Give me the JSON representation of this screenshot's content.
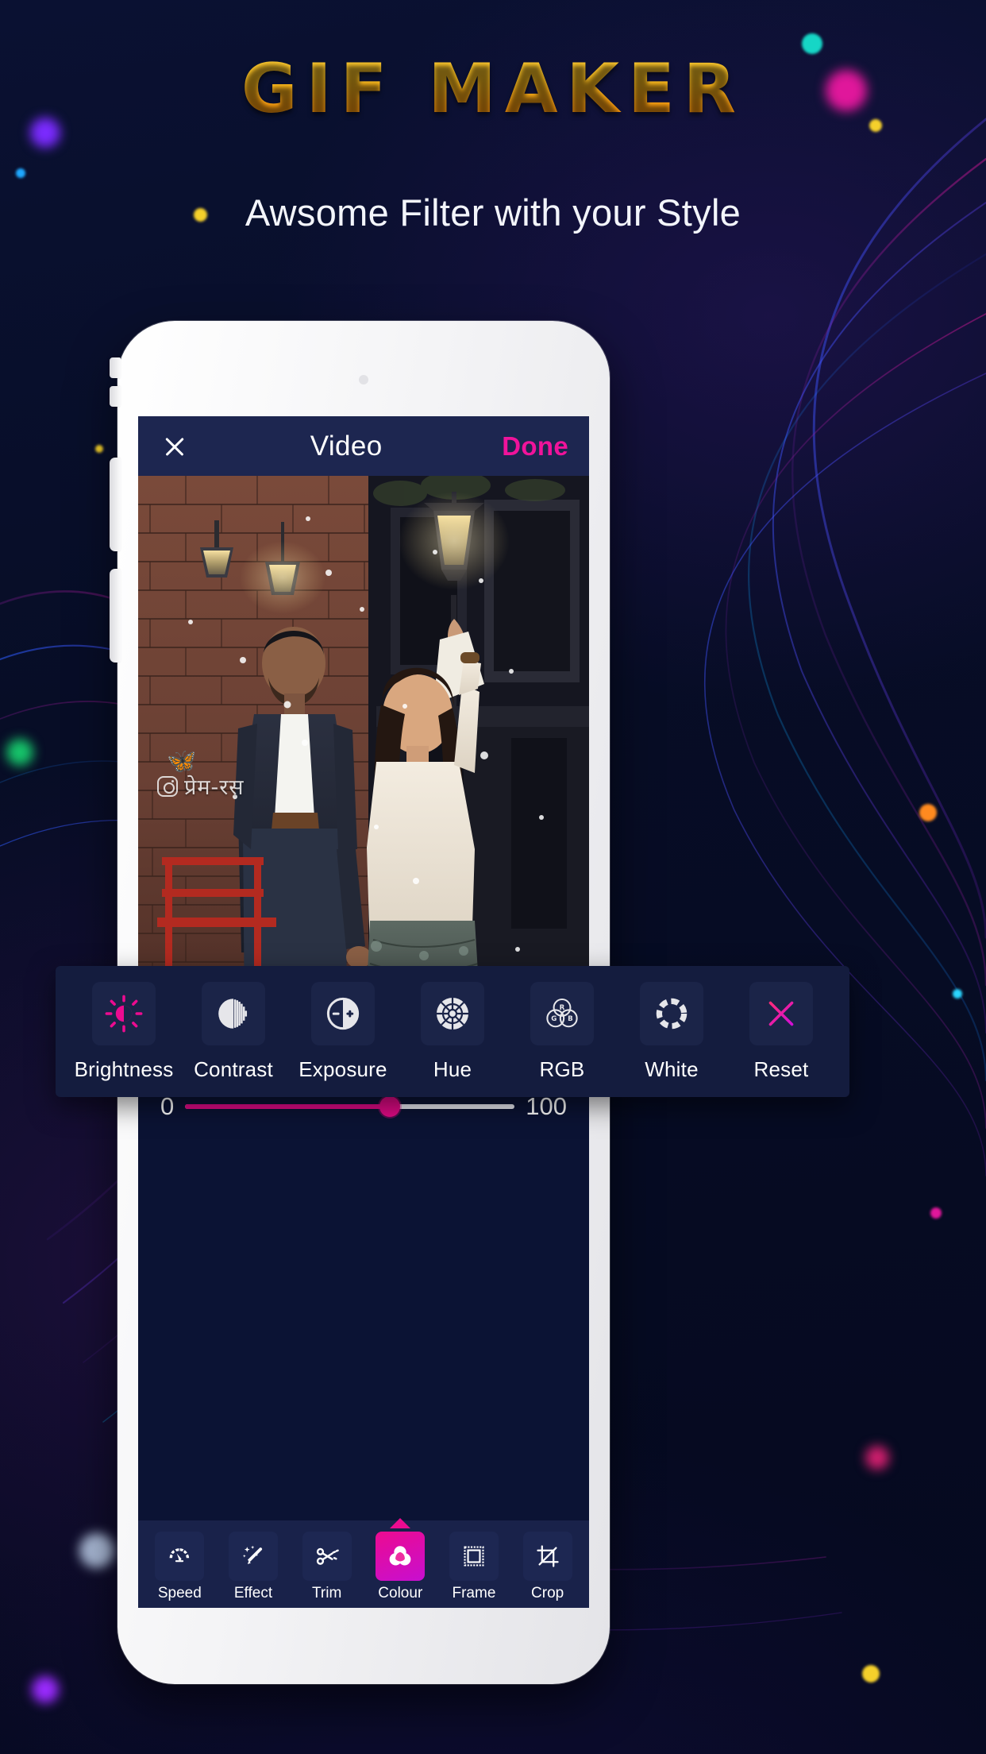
{
  "hero": {
    "title": "GIF MAKER",
    "subtitle": "Awsome Filter with your Style",
    "title_gradient_from": "#ffd23a",
    "title_gradient_to": "#ff8c05"
  },
  "app": {
    "header": {
      "close_icon": "close-icon",
      "title": "Video",
      "done_label": "Done",
      "done_color": "#f0139b",
      "bar_color": "#1d2650"
    },
    "preview": {
      "watermark_handle": "प्रेम-रस",
      "watermark_icon": "instagram-icon"
    },
    "adjust": {
      "name": "Brightness",
      "min_label": "0",
      "max_label": "100",
      "value": 62,
      "fill_color": "#e20a87",
      "track_color": "#e9eaf2"
    },
    "filter_panel": {
      "items": [
        {
          "label": "Brightness",
          "icon": "brightness-sun-icon",
          "active": true
        },
        {
          "label": "Contrast",
          "icon": "contrast-circle-icon",
          "active": false
        },
        {
          "label": "Exposure",
          "icon": "exposure-plusminus-icon",
          "active": false
        },
        {
          "label": "Hue",
          "icon": "hue-wheel-icon",
          "active": false
        },
        {
          "label": "RGB",
          "icon": "rgb-venn-icon",
          "active": false
        },
        {
          "label": "White",
          "icon": "white-balance-dashed-ring-icon",
          "active": false
        },
        {
          "label": "Reset",
          "icon": "reset-x-icon",
          "active": false
        }
      ],
      "accent_color": "#e20a87",
      "panel_color": "#141c3e"
    },
    "bottom_nav": {
      "items": [
        {
          "label": "Speed",
          "icon": "speedometer-icon",
          "active": false
        },
        {
          "label": "Effect",
          "icon": "magic-wand-icon",
          "active": false
        },
        {
          "label": "Trim",
          "icon": "scissors-icon",
          "active": false
        },
        {
          "label": "Colour",
          "icon": "colour-venn-icon",
          "active": true
        },
        {
          "label": "Frame",
          "icon": "frame-stamp-icon",
          "active": false
        },
        {
          "label": "Crop",
          "icon": "crop-icon",
          "active": false
        }
      ],
      "active_gradient_from": "#ec0b90",
      "active_gradient_to": "#c70fd0"
    }
  },
  "rgb_icon_letters": {
    "r": "R",
    "g": "G",
    "b": "B"
  }
}
